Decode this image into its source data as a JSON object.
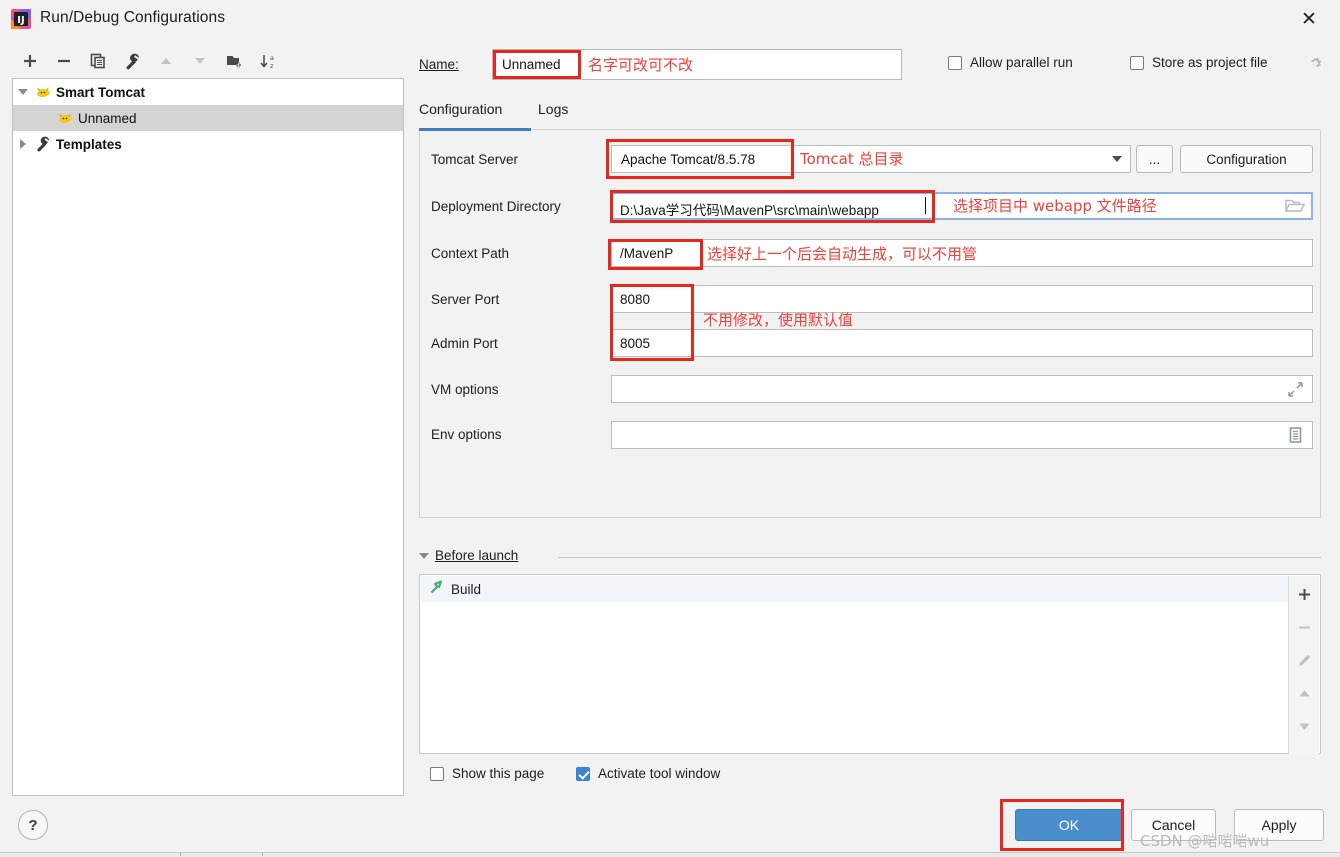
{
  "window": {
    "title": "Run/Debug Configurations",
    "close_label": "✕",
    "app_icon": "intellij-idea-icon"
  },
  "left_panel": {
    "toolbar": [
      {
        "name": "add-configuration-button",
        "icon": "plus-icon",
        "enabled": true
      },
      {
        "name": "remove-configuration-button",
        "icon": "minus-icon",
        "enabled": true
      },
      {
        "name": "copy-configuration-button",
        "icon": "copy-icon",
        "enabled": true
      },
      {
        "name": "edit-templates-button",
        "icon": "wrench-icon",
        "enabled": true
      },
      {
        "name": "move-up-button",
        "icon": "arrow-up-icon",
        "enabled": false
      },
      {
        "name": "move-down-button",
        "icon": "arrow-down-icon",
        "enabled": false
      },
      {
        "name": "new-folder-button",
        "icon": "folder-add-icon",
        "enabled": true
      },
      {
        "name": "sort-alphabetically-button",
        "icon": "sort-az-icon",
        "enabled": true
      }
    ],
    "tree": [
      {
        "label": "Smart Tomcat",
        "icon": "tomcat-icon",
        "expanded": true,
        "bold": true,
        "selected": false,
        "indent": 0
      },
      {
        "label": "Unnamed",
        "icon": "tomcat-icon",
        "expanded": null,
        "bold": false,
        "selected": true,
        "indent": 1
      },
      {
        "label": "Templates",
        "icon": "wrench-icon",
        "expanded": false,
        "bold": true,
        "selected": false,
        "indent": 0
      }
    ],
    "help_label": "?"
  },
  "header": {
    "name_label": "Name:",
    "name_value": "Unnamed",
    "name_annotation": "名字可改可不改",
    "allow_parallel_run": {
      "label": "Allow parallel run",
      "checked": false
    },
    "store_as_project_file": {
      "label": "Store as project file",
      "checked": false
    },
    "gear_icon": "gear-icon"
  },
  "tabs": [
    {
      "label": "Configuration",
      "active": true
    },
    {
      "label": "Logs",
      "active": false
    }
  ],
  "form": {
    "tomcat_server": {
      "label": "Tomcat Server",
      "value": "Apache Tomcat/8.5.78",
      "annotation": "Tomcat 总目录",
      "browse_label": "...",
      "configuration_label": "Configuration"
    },
    "deployment_directory": {
      "label": "Deployment Directory",
      "value": "D:\\Java学习代码\\MavenP\\src\\main\\webapp",
      "annotation": "选择项目中 webapp 文件路径",
      "browse_icon": "folder-open-icon"
    },
    "context_path": {
      "label": "Context Path",
      "value": "/MavenP",
      "annotation": "选择好上一个后会自动生成，可以不用管"
    },
    "server_port": {
      "label": "Server Port",
      "value": "8080"
    },
    "admin_port": {
      "label": "Admin Port",
      "value": "8005",
      "annotation": "不用修改，使用默认值"
    },
    "vm_options": {
      "label": "VM options",
      "value": "",
      "expand_icon": "expand-icon"
    },
    "env_options": {
      "label": "Env options",
      "value": "",
      "list_icon": "list-icon"
    }
  },
  "before_launch": {
    "title": "Before launch",
    "expanded": true,
    "items": [
      {
        "label": "Build",
        "icon": "build-hammer-icon"
      }
    ],
    "side_buttons": [
      {
        "name": "add-task-button",
        "icon": "plus-icon",
        "enabled": true
      },
      {
        "name": "remove-task-button",
        "icon": "minus-icon",
        "enabled": false
      },
      {
        "name": "edit-task-button",
        "icon": "pencil-icon",
        "enabled": false
      },
      {
        "name": "move-task-up-button",
        "icon": "arrow-up-icon",
        "enabled": false
      },
      {
        "name": "move-task-down-button",
        "icon": "arrow-down-icon",
        "enabled": false
      }
    ],
    "show_this_page": {
      "label": "Show this page",
      "checked": false
    },
    "activate_tool_window": {
      "label": "Activate tool window",
      "checked": true
    }
  },
  "footer": {
    "ok_label": "OK",
    "cancel_label": "Cancel",
    "apply_label": "Apply"
  },
  "watermark": "CSDN @啱啱啱wu",
  "colors": {
    "annotation_red": "#f0403a",
    "highlight_box_red": "#e8261c",
    "accent_blue": "#4a8ecb",
    "tab_underline": "#3e7fc4",
    "selection_gray": "#d4d4d4"
  }
}
